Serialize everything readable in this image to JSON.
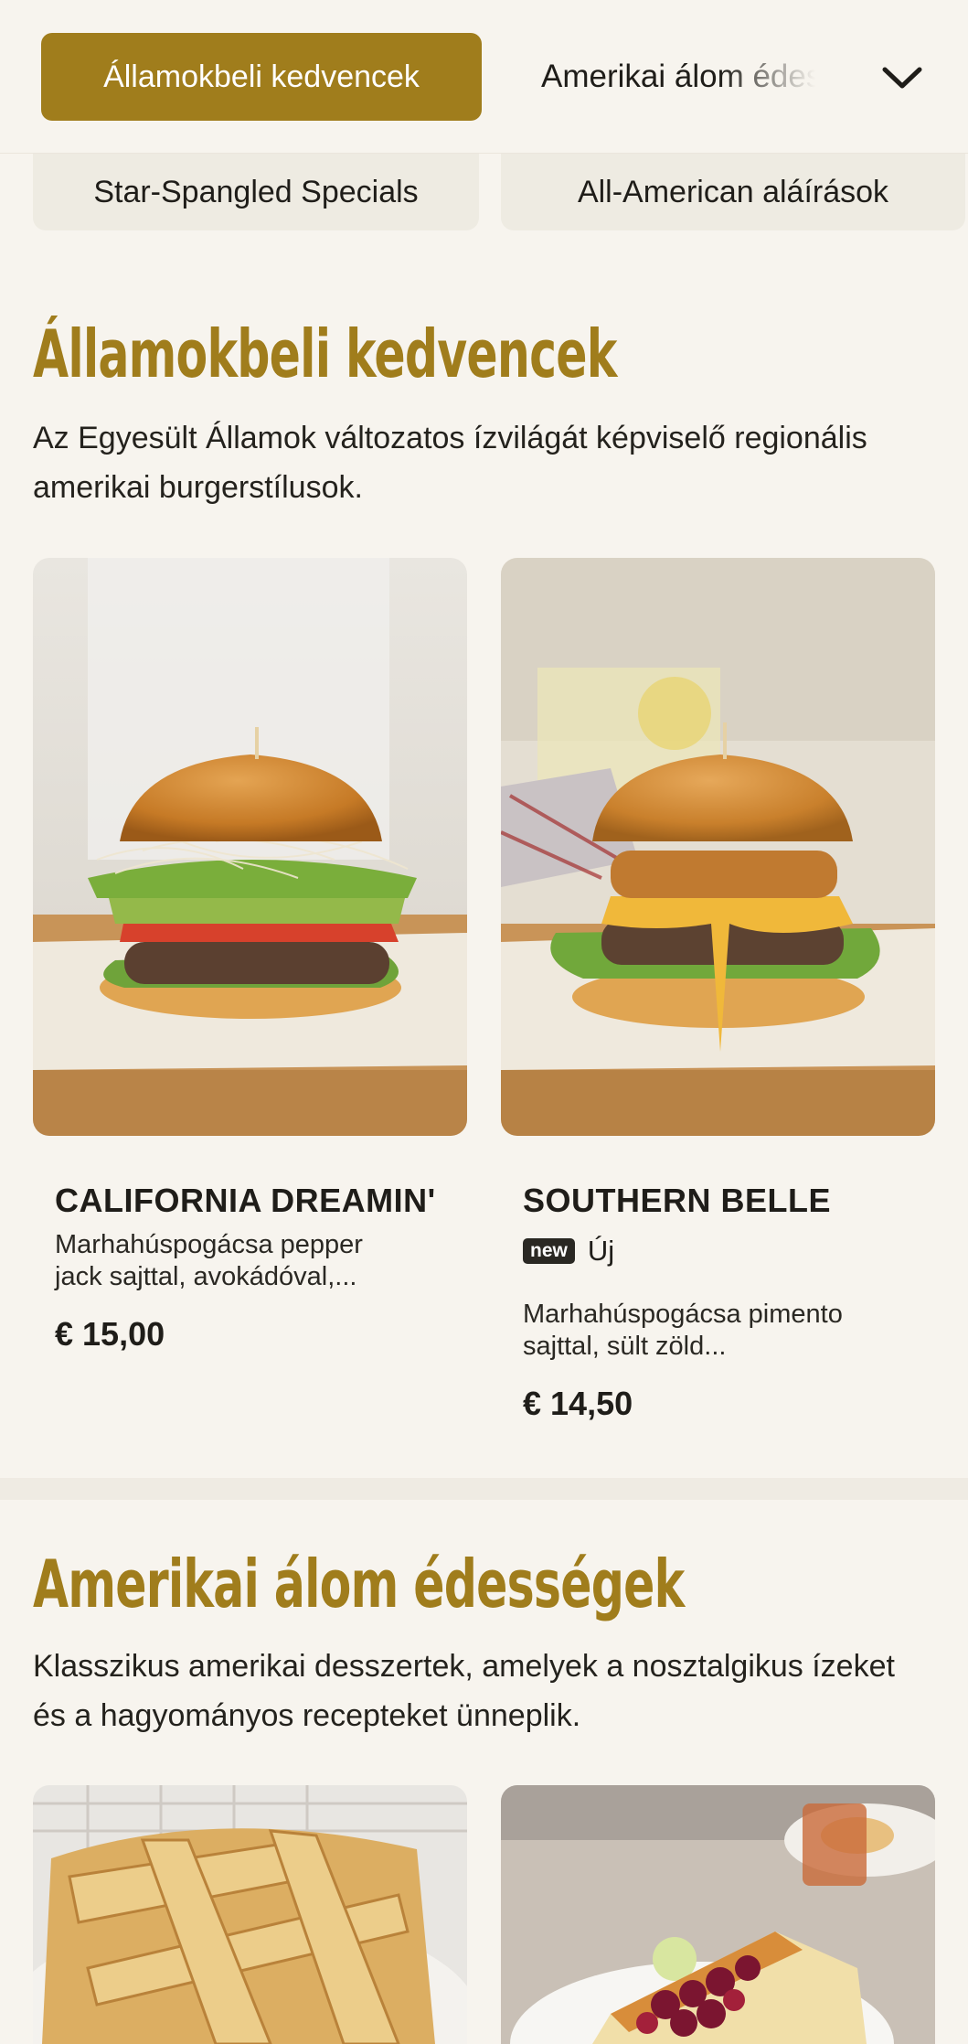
{
  "topbar": {
    "active_category": "Államokbeli kedvencek",
    "next_category": "Amerikai álom édességek",
    "dropdown_icon": "chevron-down-icon"
  },
  "subnav": {
    "items": [
      {
        "label": "Star-Spangled Specials"
      },
      {
        "label": "All-American aláírások"
      }
    ]
  },
  "sections": [
    {
      "title": "Államokbeli kedvencek",
      "description": "Az Egyesült Államok változatos ízvilágát képviselő regionális amerikai burgerstílusok.",
      "items": [
        {
          "name": "CALIFORNIA DREAMIN'",
          "description_line1": "Marhahúspogácsa pepper",
          "description_line2": "jack sajttal, avokádóval,...",
          "price": "€ 15,00"
        },
        {
          "name": "SOUTHERN BELLE",
          "badge": "new",
          "badge_label": "Új",
          "description_line1": "Marhahúspogácsa pimento",
          "description_line2": "sajttal, sült zöld...",
          "price": "€ 14,50"
        }
      ]
    },
    {
      "title": "Amerikai álom édességek",
      "description": "Klasszikus amerikai desszertek, amelyek a nosztalgikus ízeket és a hagyományos recepteket ünneplik."
    }
  ],
  "colors": {
    "accent": "#a07d1c",
    "background": "#f7f4ee",
    "pill": "#eeebe2"
  }
}
